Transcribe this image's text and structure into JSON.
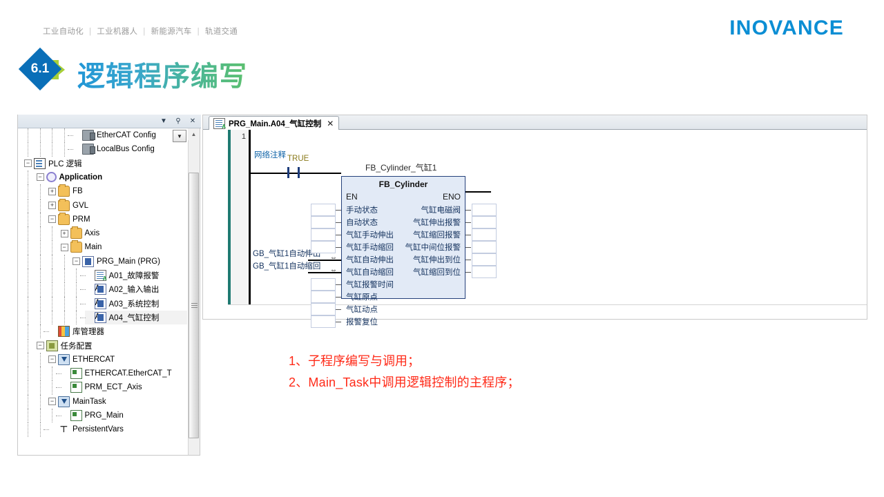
{
  "header": {
    "nav": [
      "工业自动化",
      "工业机器人",
      "新能源汽车",
      "轨道交通"
    ],
    "logo": "INOVANCE",
    "brand_color": "#0b8ed4"
  },
  "title_band": {
    "number": "6.1",
    "title": "逻辑程序编写",
    "badge_color": "#0a6fb8",
    "arrow_color": "#a8cf38"
  },
  "tree_panel": {
    "header_icons": [
      "chevron-down-icon",
      "pin-icon",
      "close-icon"
    ],
    "combo_icon": "dropdown-arrow-icon",
    "scroll_up_icon": "scroll-up-arrow",
    "nodes": [
      {
        "label": "EtherCAT Config",
        "icon": "device-icon",
        "indent": 4,
        "toggle": "none",
        "bold": false
      },
      {
        "label": "LocalBus Config",
        "icon": "device-icon",
        "indent": 4,
        "toggle": "none",
        "bold": false
      },
      {
        "label": "PLC 逻辑",
        "icon": "plc-icon",
        "indent": 0,
        "toggle": "minus",
        "bold": false
      },
      {
        "label": "Application",
        "icon": "application-icon",
        "indent": 1,
        "toggle": "minus",
        "bold": true
      },
      {
        "label": "FB",
        "icon": "folder-icon",
        "indent": 2,
        "toggle": "plus",
        "bold": false
      },
      {
        "label": "GVL",
        "icon": "folder-icon",
        "indent": 2,
        "toggle": "plus",
        "bold": false
      },
      {
        "label": "PRM",
        "icon": "folder-icon",
        "indent": 2,
        "toggle": "minus",
        "bold": false
      },
      {
        "label": "Axis",
        "icon": "folder-icon",
        "indent": 3,
        "toggle": "plus",
        "bold": false
      },
      {
        "label": "Main",
        "icon": "folder-icon",
        "indent": 3,
        "toggle": "minus",
        "bold": false
      },
      {
        "label": "PRG_Main (PRG)",
        "icon": "program-icon",
        "indent": 4,
        "toggle": "minus",
        "bold": false
      },
      {
        "label": "A01_故障报警",
        "icon": "action-doc-icon",
        "indent": 5,
        "toggle": "none",
        "bold": false
      },
      {
        "label": "A02_输入输出",
        "icon": "action-ld-icon",
        "indent": 5,
        "toggle": "none",
        "bold": false
      },
      {
        "label": "A03_系统控制",
        "icon": "action-ld-icon",
        "indent": 5,
        "toggle": "none",
        "bold": false
      },
      {
        "label": "A04_气缸控制",
        "icon": "action-ld-icon",
        "indent": 5,
        "toggle": "none",
        "bold": false,
        "selected": true
      },
      {
        "label": "库管理器",
        "icon": "library-icon",
        "indent": 2,
        "toggle": "none",
        "bold": false
      },
      {
        "label": "任务配置",
        "icon": "task-config-icon",
        "indent": 1,
        "toggle": "minus",
        "bold": false
      },
      {
        "label": "ETHERCAT",
        "icon": "task-icon",
        "indent": 2,
        "toggle": "minus",
        "bold": false
      },
      {
        "label": "ETHERCAT.EtherCAT_T",
        "icon": "call-icon",
        "indent": 3,
        "toggle": "none",
        "bold": false
      },
      {
        "label": "PRM_ECT_Axis",
        "icon": "call-icon",
        "indent": 3,
        "toggle": "none",
        "bold": false
      },
      {
        "label": "MainTask",
        "icon": "task-icon",
        "indent": 2,
        "toggle": "minus",
        "bold": false
      },
      {
        "label": "PRG_Main",
        "icon": "call-icon",
        "indent": 3,
        "toggle": "none",
        "bold": false
      },
      {
        "label": "PersistentVars",
        "icon": "persistent-vars-icon",
        "indent": 2,
        "toggle": "none",
        "bold": false
      }
    ]
  },
  "editor": {
    "tab": {
      "label": "PRG_Main.A04_气缸控制",
      "icon": "action-ld-icon",
      "close": "✕"
    },
    "network": {
      "number": "1",
      "comment": "网络注释",
      "contact_label": "TRUE"
    },
    "fb": {
      "instance_name": "FB_Cylinder_气缸1",
      "type_name": "FB_Cylinder",
      "en": "EN",
      "eno": "ENO",
      "inputs": [
        "手动状态",
        "自动状态",
        "气缸手动伸出",
        "气缸手动缩回",
        "气缸自动伸出",
        "气缸自动缩回",
        "气缸报警时间",
        "气缸原点",
        "气缸动点",
        "报警复位"
      ],
      "outputs": [
        "气缸电磁阀",
        "气缸伸出报警",
        "气缸缩回报警",
        "气缸中间位报警",
        "气缸伸出到位",
        "气缸缩回到位"
      ],
      "connected_inputs": [
        {
          "index": 4,
          "value": "GB_气缸1自动伸出"
        },
        {
          "index": 5,
          "value": "GB_气缸1自动缩回"
        }
      ]
    }
  },
  "notes": {
    "line1": "1、子程序编写与调用；",
    "line2": "2、Main_Task中调用逻辑控制的主程序；",
    "color": "#ff2a18"
  }
}
